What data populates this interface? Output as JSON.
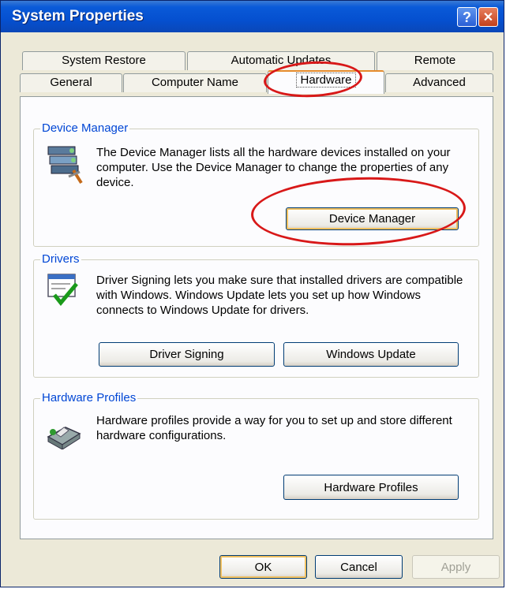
{
  "window": {
    "title": "System Properties",
    "help_glyph": "?",
    "close_glyph": "✕"
  },
  "tabs": {
    "row1": [
      "System Restore",
      "Automatic Updates",
      "Remote"
    ],
    "row2": [
      "General",
      "Computer Name",
      "Hardware",
      "Advanced"
    ],
    "active": "Hardware"
  },
  "device_manager": {
    "label": "Device Manager",
    "description": "The Device Manager lists all the hardware devices installed on your computer. Use the Device Manager to change the properties of any device.",
    "button": "Device Manager"
  },
  "drivers": {
    "label": "Drivers",
    "description": "Driver Signing lets you make sure that installed drivers are compatible with Windows. Windows Update lets you set up how Windows connects to Windows Update for drivers.",
    "signing_button": "Driver Signing",
    "update_button": "Windows Update"
  },
  "hardware_profiles": {
    "label": "Hardware Profiles",
    "description": "Hardware profiles provide a way for you to set up and store different hardware configurations.",
    "button": "Hardware Profiles"
  },
  "footer": {
    "ok": "OK",
    "cancel": "Cancel",
    "apply": "Apply"
  },
  "colors": {
    "annotation": "#d81818",
    "titlebar": "#0a5ad8",
    "group_label": "#0046d5",
    "active_tab_highlight": "#e68b2c"
  }
}
